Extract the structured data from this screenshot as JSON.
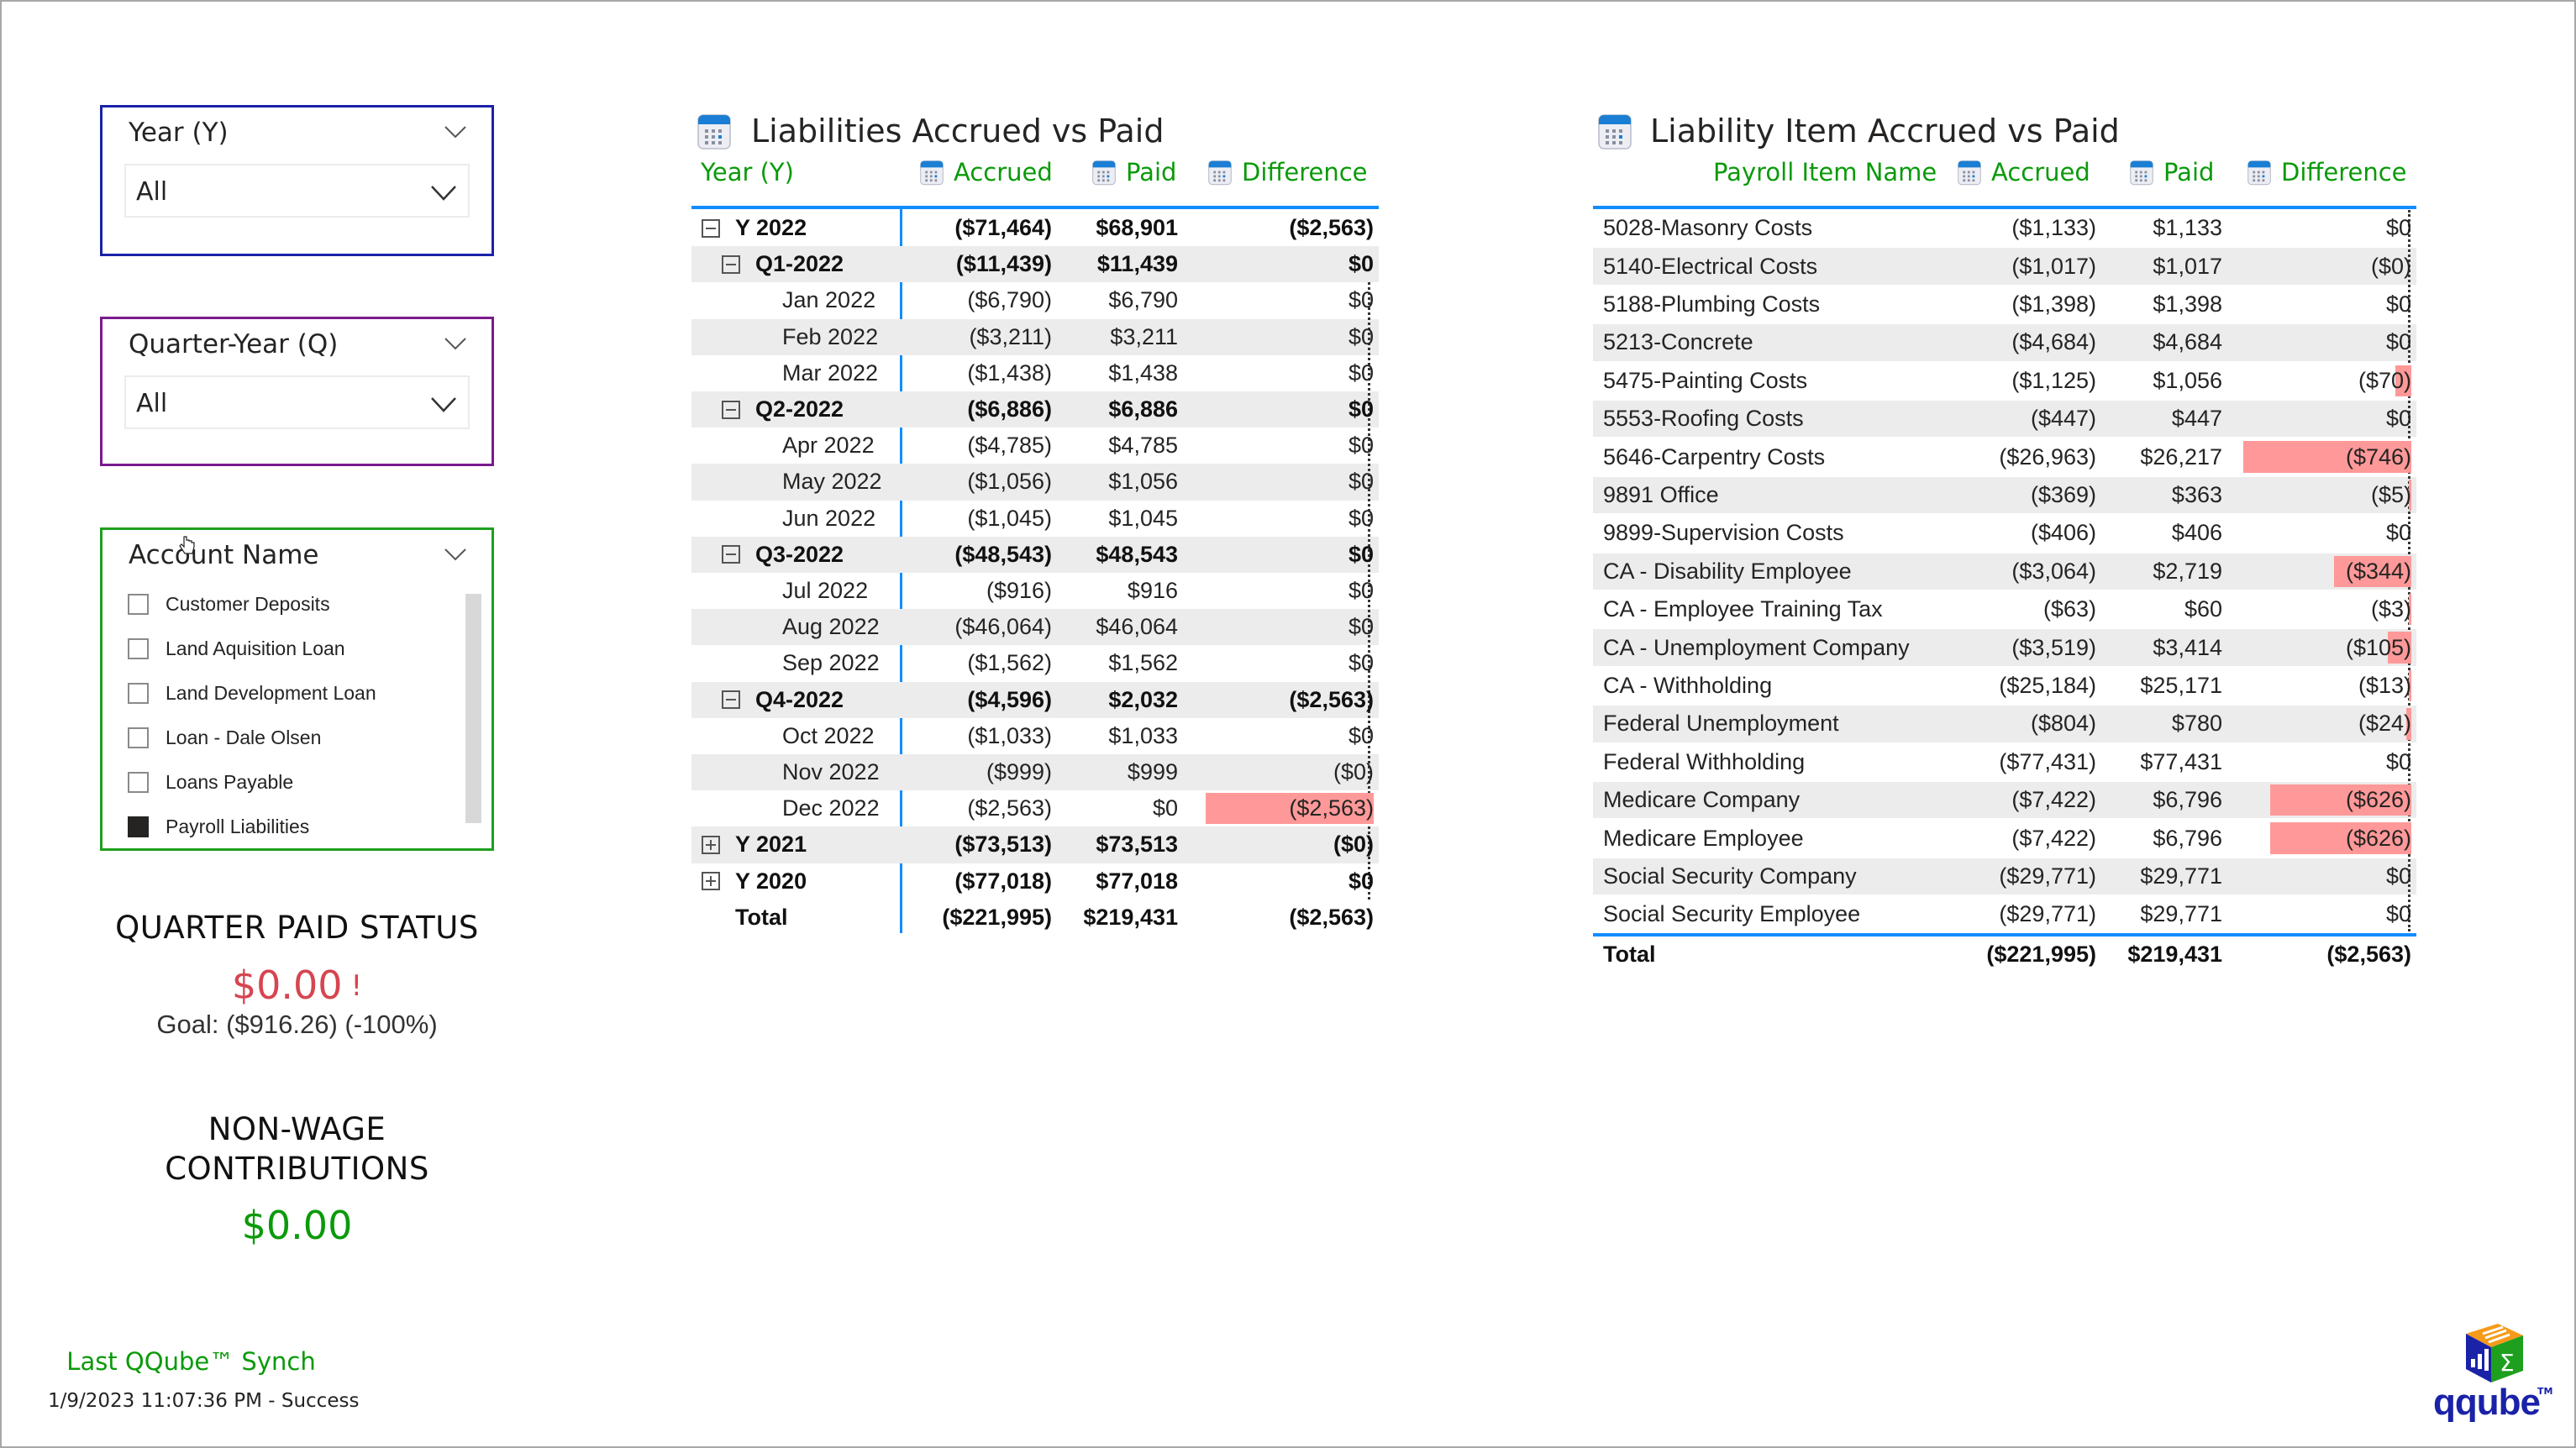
{
  "filters": {
    "year": {
      "title": "Year (Y)",
      "value": "All"
    },
    "quarter": {
      "title": "Quarter-Year (Q)",
      "value": "All"
    },
    "account": {
      "title": "Account Name",
      "items": [
        {
          "label": "Customer Deposits",
          "checked": false
        },
        {
          "label": "Land Aquisition Loan",
          "checked": false
        },
        {
          "label": "Land Development Loan",
          "checked": false
        },
        {
          "label": "Loan - Dale Olsen",
          "checked": false
        },
        {
          "label": "Loans Payable",
          "checked": false
        },
        {
          "label": "Payroll Liabilities",
          "checked": true
        }
      ]
    }
  },
  "kpis": {
    "quarter_paid_status": {
      "title": "QUARTER PAID STATUS",
      "value": "$0.00",
      "indicator": "!",
      "goal": "Goal: ($916.26) (-100%)",
      "color": "#d64550"
    },
    "non_wage": {
      "title_line1": "NON-WAGE",
      "title_line2": "CONTRIBUTIONS",
      "value": "$0.00",
      "color": "#0a9a0a"
    }
  },
  "sync": {
    "title": "Last QQube™ Synch",
    "timestamp": "1/9/2023 11:07:36 PM - Success"
  },
  "logo": {
    "text": "qqube",
    "tm": "TM"
  },
  "colors": {
    "header_green": "#0a9a0a",
    "accent_blue": "#118dff",
    "negative_bar": "#ff9999",
    "alt_row": "#ececec"
  },
  "liabilities_table": {
    "title": "Liabilities Accrued vs Paid",
    "columns": [
      "Year (Y)",
      "Accrued",
      "Paid",
      "Difference"
    ],
    "rows": [
      {
        "label": "Y 2022",
        "level": 0,
        "expander": "minus",
        "bold": true,
        "accrued": "($71,464)",
        "paid": "$68,901",
        "difference": "($2,563)",
        "bar": 0
      },
      {
        "label": "Q1-2022",
        "level": 1,
        "expander": "minus",
        "bold": true,
        "accrued": "($11,439)",
        "paid": "$11,439",
        "difference": "$0",
        "bar": 0
      },
      {
        "label": "Jan 2022",
        "level": 2,
        "expander": "",
        "bold": false,
        "accrued": "($6,790)",
        "paid": "$6,790",
        "difference": "$0",
        "bar": 0
      },
      {
        "label": "Feb 2022",
        "level": 2,
        "expander": "",
        "bold": false,
        "accrued": "($3,211)",
        "paid": "$3,211",
        "difference": "$0",
        "bar": 0
      },
      {
        "label": "Mar 2022",
        "level": 2,
        "expander": "",
        "bold": false,
        "accrued": "($1,438)",
        "paid": "$1,438",
        "difference": "$0",
        "bar": 0
      },
      {
        "label": "Q2-2022",
        "level": 1,
        "expander": "minus",
        "bold": true,
        "accrued": "($6,886)",
        "paid": "$6,886",
        "difference": "$0",
        "bar": 0
      },
      {
        "label": "Apr 2022",
        "level": 2,
        "expander": "",
        "bold": false,
        "accrued": "($4,785)",
        "paid": "$4,785",
        "difference": "$0",
        "bar": 0
      },
      {
        "label": "May 2022",
        "level": 2,
        "expander": "",
        "bold": false,
        "accrued": "($1,056)",
        "paid": "$1,056",
        "difference": "$0",
        "bar": 0
      },
      {
        "label": "Jun 2022",
        "level": 2,
        "expander": "",
        "bold": false,
        "accrued": "($1,045)",
        "paid": "$1,045",
        "difference": "$0",
        "bar": 0
      },
      {
        "label": "Q3-2022",
        "level": 1,
        "expander": "minus",
        "bold": true,
        "accrued": "($48,543)",
        "paid": "$48,543",
        "difference": "$0",
        "bar": 0
      },
      {
        "label": "Jul 2022",
        "level": 2,
        "expander": "",
        "bold": false,
        "accrued": "($916)",
        "paid": "$916",
        "difference": "$0",
        "bar": 0
      },
      {
        "label": "Aug 2022",
        "level": 2,
        "expander": "",
        "bold": false,
        "accrued": "($46,064)",
        "paid": "$46,064",
        "difference": "$0",
        "bar": 0
      },
      {
        "label": "Sep 2022",
        "level": 2,
        "expander": "",
        "bold": false,
        "accrued": "($1,562)",
        "paid": "$1,562",
        "difference": "$0",
        "bar": 0
      },
      {
        "label": "Q4-2022",
        "level": 1,
        "expander": "minus",
        "bold": true,
        "accrued": "($4,596)",
        "paid": "$2,032",
        "difference": "($2,563)",
        "bar": 0
      },
      {
        "label": "Oct 2022",
        "level": 2,
        "expander": "",
        "bold": false,
        "accrued": "($1,033)",
        "paid": "$1,033",
        "difference": "$0",
        "bar": 0
      },
      {
        "label": "Nov 2022",
        "level": 2,
        "expander": "",
        "bold": false,
        "accrued": "($999)",
        "paid": "$999",
        "difference": "($0)",
        "bar": 0
      },
      {
        "label": "Dec 2022",
        "level": 2,
        "expander": "",
        "bold": false,
        "accrued": "($2,563)",
        "paid": "$0",
        "difference": "($2,563)",
        "bar": 1.0
      },
      {
        "label": "Y 2021",
        "level": 0,
        "expander": "plus",
        "bold": true,
        "accrued": "($73,513)",
        "paid": "$73,513",
        "difference": "($0)",
        "bar": 0
      },
      {
        "label": "Y 2020",
        "level": 0,
        "expander": "plus",
        "bold": true,
        "accrued": "($77,018)",
        "paid": "$77,018",
        "difference": "$0",
        "bar": 0
      }
    ],
    "total": {
      "label": "Total",
      "accrued": "($221,995)",
      "paid": "$219,431",
      "difference": "($2,563)"
    }
  },
  "items_table": {
    "title": "Liability Item Accrued vs Paid",
    "columns": [
      "Payroll Item Name",
      "Accrued",
      "Paid",
      "Difference"
    ],
    "rows": [
      {
        "label": "5028-Masonry Costs",
        "accrued": "($1,133)",
        "paid": "$1,133",
        "difference": "$0",
        "bar": 0
      },
      {
        "label": "5140-Electrical Costs",
        "accrued": "($1,017)",
        "paid": "$1,017",
        "difference": "($0)",
        "bar": 0
      },
      {
        "label": "5188-Plumbing Costs",
        "accrued": "($1,398)",
        "paid": "$1,398",
        "difference": "$0",
        "bar": 0
      },
      {
        "label": "5213-Concrete",
        "accrued": "($4,684)",
        "paid": "$4,684",
        "difference": "$0",
        "bar": 0
      },
      {
        "label": "5475-Painting Costs",
        "accrued": "($1,125)",
        "paid": "$1,056",
        "difference": "($70)",
        "bar": 0.094
      },
      {
        "label": "5553-Roofing Costs",
        "accrued": "($447)",
        "paid": "$447",
        "difference": "$0",
        "bar": 0
      },
      {
        "label": "5646-Carpentry Costs",
        "accrued": "($26,963)",
        "paid": "$26,217",
        "difference": "($746)",
        "bar": 1.0
      },
      {
        "label": "9891 Office",
        "accrued": "($369)",
        "paid": "$363",
        "difference": "($5)",
        "bar": 0.007
      },
      {
        "label": "9899-Supervision Costs",
        "accrued": "($406)",
        "paid": "$406",
        "difference": "$0",
        "bar": 0
      },
      {
        "label": "CA - Disability Employee",
        "accrued": "($3,064)",
        "paid": "$2,719",
        "difference": "($344)",
        "bar": 0.461
      },
      {
        "label": "CA - Employee Training Tax",
        "accrued": "($63)",
        "paid": "$60",
        "difference": "($3)",
        "bar": 0.004
      },
      {
        "label": "CA - Unemployment Company",
        "accrued": "($3,519)",
        "paid": "$3,414",
        "difference": "($105)",
        "bar": 0.141
      },
      {
        "label": "CA - Withholding",
        "accrued": "($25,184)",
        "paid": "$25,171",
        "difference": "($13)",
        "bar": 0.017
      },
      {
        "label": "Federal Unemployment",
        "accrued": "($804)",
        "paid": "$780",
        "difference": "($24)",
        "bar": 0.032
      },
      {
        "label": "Federal Withholding",
        "accrued": "($77,431)",
        "paid": "$77,431",
        "difference": "$0",
        "bar": 0
      },
      {
        "label": "Medicare Company",
        "accrued": "($7,422)",
        "paid": "$6,796",
        "difference": "($626)",
        "bar": 0.839
      },
      {
        "label": "Medicare Employee",
        "accrued": "($7,422)",
        "paid": "$6,796",
        "difference": "($626)",
        "bar": 0.839
      },
      {
        "label": "Social Security Company",
        "accrued": "($29,771)",
        "paid": "$29,771",
        "difference": "$0",
        "bar": 0
      },
      {
        "label": "Social Security Employee",
        "accrued": "($29,771)",
        "paid": "$29,771",
        "difference": "$0",
        "bar": 0
      }
    ],
    "total": {
      "label": "Total",
      "accrued": "($221,995)",
      "paid": "$219,431",
      "difference": "($2,563)"
    }
  }
}
